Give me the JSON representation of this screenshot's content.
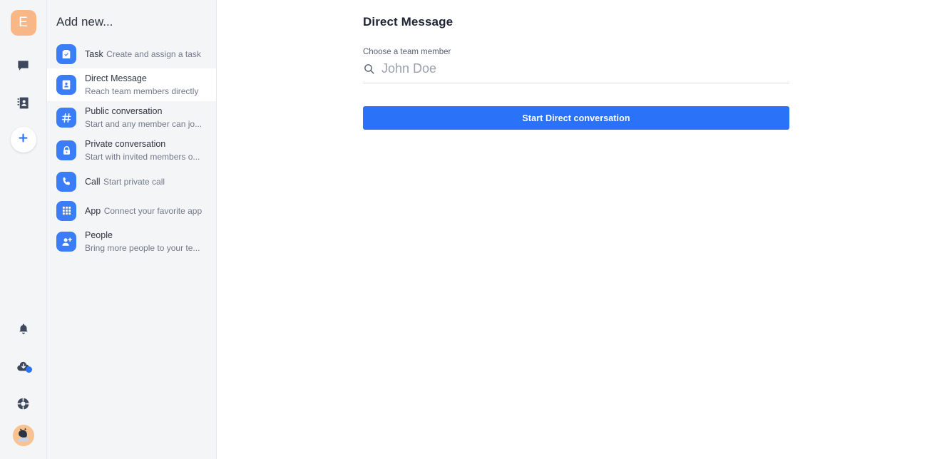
{
  "rail": {
    "team_avatar_letter": "E",
    "items": [
      {
        "name": "chat-icon",
        "label": "Chat"
      },
      {
        "name": "contacts-icon",
        "label": "Contacts"
      },
      {
        "name": "plus-icon",
        "label": "Add new"
      }
    ],
    "bottom_items": [
      {
        "name": "bell-icon",
        "label": "Notifications"
      },
      {
        "name": "cloud-download-icon",
        "label": "Downloads"
      },
      {
        "name": "lifebuoy-icon",
        "label": "Help"
      },
      {
        "name": "avatar",
        "label": "Profile"
      }
    ]
  },
  "panel": {
    "title": "Add new...",
    "items": [
      {
        "icon": "clipboard-check-icon",
        "title": "Task",
        "subtitle": "Create and assign a task",
        "selected": false
      },
      {
        "icon": "contact-card-icon",
        "title": "Direct Message",
        "subtitle": "Reach team members directly",
        "selected": true
      },
      {
        "icon": "hash-icon",
        "title": "Public conversation",
        "subtitle": "Start and any member can jo...",
        "selected": false
      },
      {
        "icon": "lock-icon",
        "title": "Private conversation",
        "subtitle": "Start with invited members o...",
        "selected": false
      },
      {
        "icon": "phone-icon",
        "title": "Call",
        "subtitle": "Start private call",
        "selected": false
      },
      {
        "icon": "grid-apps-icon",
        "title": "App",
        "subtitle": "Connect your favorite app",
        "selected": false
      },
      {
        "icon": "person-add-icon",
        "title": "People",
        "subtitle": "Bring more people to your te...",
        "selected": false
      }
    ]
  },
  "main": {
    "title": "Direct Message",
    "field_label": "Choose a team member",
    "search_value": "",
    "search_placeholder": "John Doe",
    "submit_label": "Start Direct conversation"
  },
  "colors": {
    "accent": "#2a72f8",
    "icon_tile": "#3b7df6",
    "panel_bg": "#f4f5f7",
    "team_avatar": "#f7b787",
    "text_primary": "#2f3542",
    "text_secondary": "#72798a"
  }
}
